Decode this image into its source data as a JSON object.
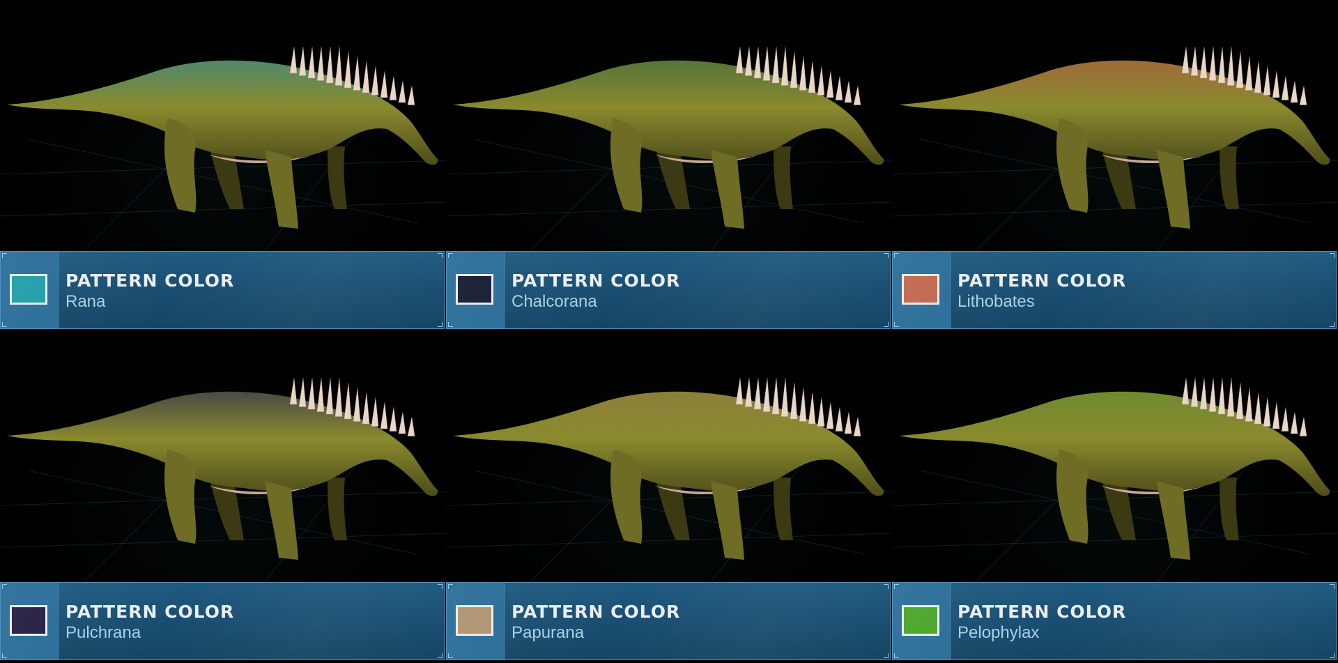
{
  "tiles": [
    {
      "heading": "PATTERN COLOR",
      "name": "Rana",
      "swatch_color": "#1f9ea8",
      "tint": "#4f8a6a"
    },
    {
      "heading": "PATTERN COLOR",
      "name": "Chalcorana",
      "swatch_color": "#161b33",
      "tint": "#56743a"
    },
    {
      "heading": "PATTERN COLOR",
      "name": "Lithobates",
      "swatch_color": "#c0694e",
      "tint": "#9e6a3a"
    },
    {
      "heading": "PATTERN COLOR",
      "name": "Pulchrana",
      "swatch_color": "#251e42",
      "tint": "#4a4a45"
    },
    {
      "heading": "PATTERN COLOR",
      "name": "Papurana",
      "swatch_color": "#b09370",
      "tint": "#8d7f3a"
    },
    {
      "heading": "PATTERN COLOR",
      "name": "Pelophylax",
      "swatch_color": "#4aa62a",
      "tint": "#6f8a30"
    }
  ],
  "colors": {
    "panel_bg": "#1a4f73",
    "panel_border": "#4f92bd",
    "heading_text": "#e9eef1",
    "value_text": "#a9cfe6",
    "dino_body": "#8a8a2e",
    "spikes": "#e8d7c8"
  }
}
